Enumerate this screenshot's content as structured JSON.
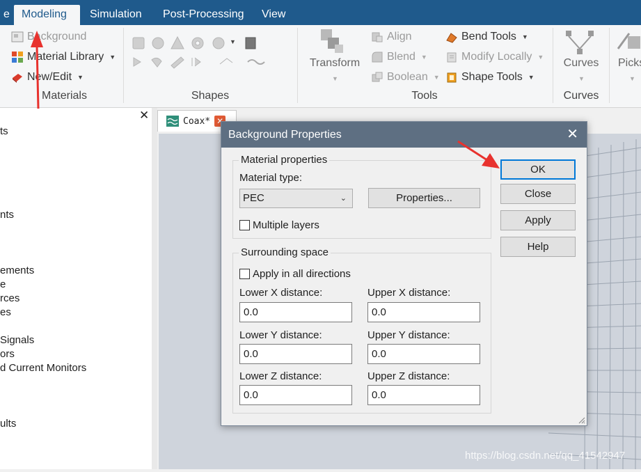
{
  "menu": {
    "tabs": [
      {
        "label": "e"
      },
      {
        "label": "Modeling"
      },
      {
        "label": "Simulation"
      },
      {
        "label": "Post-Processing"
      },
      {
        "label": "View"
      }
    ],
    "active_tab": "Modeling"
  },
  "ribbon": {
    "materials": {
      "background": "Background",
      "material_library": "Material Library",
      "new_edit": "New/Edit",
      "group_label": "Materials"
    },
    "shapes": {
      "group_label": "Shapes"
    },
    "tools": {
      "transform": "Transform",
      "align": "Align",
      "blend": "Blend",
      "boolean": "Boolean",
      "bend_tools": "Bend Tools",
      "modify_locally": "Modify Locally",
      "shape_tools": "Shape Tools",
      "group_label": "Tools"
    },
    "curves": {
      "button": "Curves",
      "group_label": "Curves"
    },
    "picks": {
      "button": "Picks"
    }
  },
  "tree": {
    "items": [
      "ts",
      "nts",
      "ements",
      "e",
      "rces",
      "es",
      "Signals",
      "ors",
      "d Current Monitors",
      "ults"
    ]
  },
  "document": {
    "tab_label": "Coax*"
  },
  "dialog": {
    "title": "Background Properties",
    "material_group": "Material properties",
    "material_type_label": "Material type:",
    "material_type_value": "PEC",
    "properties_button": "Properties...",
    "multiple_layers": "Multiple layers",
    "surrounding_group": "Surrounding space",
    "apply_all_directions": "Apply in all directions",
    "lower_x_label": "Lower X distance:",
    "upper_x_label": "Upper X distance:",
    "lower_y_label": "Lower Y distance:",
    "upper_y_label": "Upper Y distance:",
    "lower_z_label": "Lower Z distance:",
    "upper_z_label": "Upper Z distance:",
    "lower_x": "0.0",
    "upper_x": "0.0",
    "lower_y": "0.0",
    "upper_y": "0.0",
    "lower_z": "0.0",
    "upper_z": "0.0",
    "ok": "OK",
    "close": "Close",
    "apply": "Apply",
    "help": "Help"
  },
  "watermark": "https://blog.csdn.net/qq_41542947",
  "colors": {
    "menu_bar": "#1f5a8c",
    "dialog_title_bar": "#5e6f82",
    "default_button_border": "#0078d7",
    "annotation_arrow": "#e8322e"
  }
}
